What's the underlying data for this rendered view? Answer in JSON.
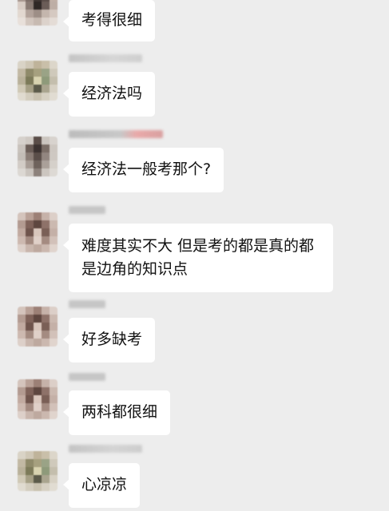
{
  "messages": [
    {
      "text": "考得很细"
    },
    {
      "text": "经济法吗"
    },
    {
      "text": "经济法一般考那个?"
    },
    {
      "text": "难度其实不大 但是考的都是真的都是边角的知识点"
    },
    {
      "text": "好多缺考"
    },
    {
      "text": "两科都很细"
    },
    {
      "text": "心凉凉"
    }
  ],
  "colors": {
    "background": "#ededed",
    "bubble": "#ffffff",
    "text": "#111111"
  }
}
